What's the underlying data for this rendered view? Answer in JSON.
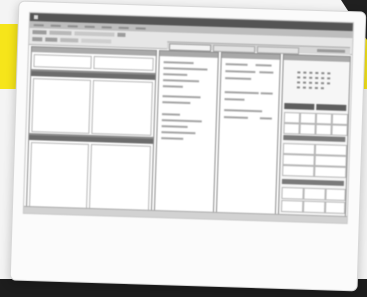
{
  "window": {
    "title_bar_text": ""
  },
  "colors": {
    "backdrop_yellow": "#f6e51a",
    "backdrop_dark": "#1d1d1d",
    "title_bar": "#545454",
    "panel_header": "#6c6c6c"
  },
  "icons": {
    "app": "app-icon"
  }
}
